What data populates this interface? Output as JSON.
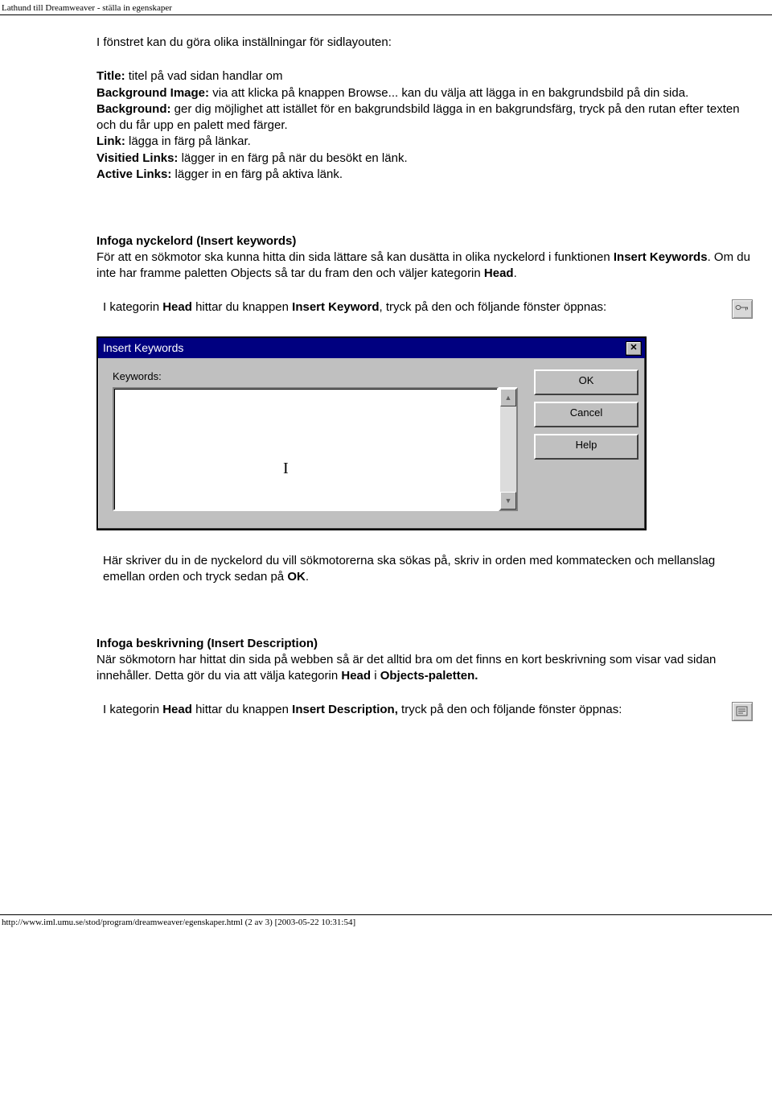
{
  "header": "Lathund till Dreamweaver - ställa in egenskaper",
  "intro": "I fönstret kan du göra olika inställningar för sidlayouten:",
  "props": {
    "title_l": "Title:",
    "title_t": " titel på vad sidan handlar om",
    "bgimg_l": "Background Image:",
    "bgimg_t": " via att klicka på knappen Browse... kan du välja att lägga in en bakgrundsbild på din sida.",
    "bg_l": "Background:",
    "bg_t": " ger dig möjlighet att istället för en bakgrundsbild lägga in en bakgrundsfärg, tryck på den rutan efter texten och du får upp en palett med färger.",
    "link_l": "Link:",
    "link_t": " lägga in färg på länkar.",
    "vlink_l": "Visitied Links:",
    "vlink_t": " lägger in en färg på när du besökt en länk.",
    "alink_l": "Active Links:",
    "alink_t": " lägger in en färg på aktiva länk."
  },
  "section_kw": {
    "heading": "Infoga nyckelord (Insert keywords)",
    "p1a": "För att en sökmotor ska kunna hitta din sida lättare så kan dusätta in olika nyckelord i funktionen ",
    "p1b": "Insert Keywords",
    "p1c": ". Om du inte har framme paletten Objects så tar du fram den och väljer kategorin ",
    "p1d": "Head",
    "p1e": ".",
    "p2a": "I kategorin ",
    "p2b": "Head",
    "p2c": " hittar du knappen ",
    "p2d": "Insert Keyword",
    "p2e": ", tryck på den och följande fönster öppnas:",
    "after1": "Här skriver du in de nyckelord du vill sökmotorerna ska sökas på, skriv in orden med kommatecken och mellanslag emellan orden och tryck sedan på ",
    "after1b": "OK",
    "after1c": "."
  },
  "dialog": {
    "title": "Insert Keywords",
    "close": "✕",
    "label": "Keywords:",
    "ok": "OK",
    "cancel": "Cancel",
    "help": "Help",
    "up": "▲",
    "down": "▼"
  },
  "section_desc": {
    "heading": "Infoga beskrivning (Insert Description)",
    "p1a": "När sökmotorn har hittat din sida på webben så är det alltid bra om det finns en kort beskrivning som visar vad sidan innehåller. Detta gör du via att välja kategorin ",
    "p1b": "Head",
    "p1c": " i ",
    "p1d": "Objects-paletten.",
    "p2a": "I kategorin ",
    "p2b": "Head",
    "p2c": " hittar du knappen ",
    "p2d": "Insert Description,",
    "p2e": " tryck på den och följande fönster öppnas:"
  },
  "footer": "http://www.iml.umu.se/stod/program/dreamweaver/egenskaper.html (2 av 3) [2003-05-22 10:31:54]"
}
